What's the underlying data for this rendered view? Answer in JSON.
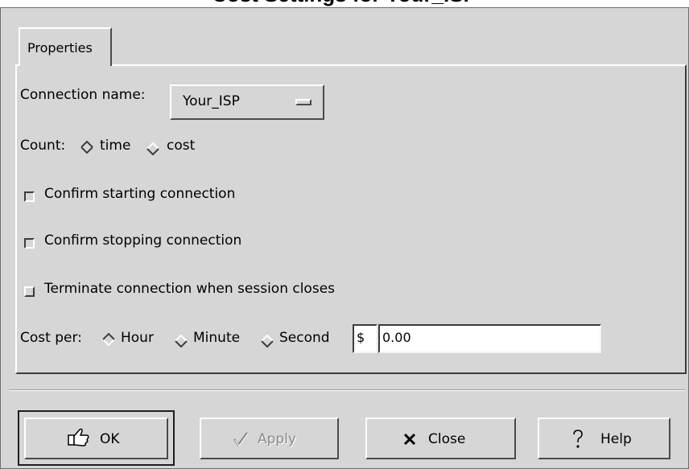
{
  "window": {
    "title": "Cost Settings for Your_ISP"
  },
  "tabs": [
    {
      "label": "Properties"
    }
  ],
  "form": {
    "connection_name_label": "Connection name:",
    "connection_name_value": "Your_ISP",
    "count_label": "Count:",
    "count_options": [
      {
        "label": "time",
        "selected": true
      },
      {
        "label": "cost",
        "selected": false
      }
    ],
    "confirm_start_label": "Confirm starting connection",
    "confirm_start_checked": false,
    "confirm_stop_label": "Confirm stopping connection",
    "confirm_stop_checked": false,
    "terminate_label": "Terminate connection when session closes",
    "terminate_checked": false,
    "cost_per_label": "Cost per:",
    "cost_per_options": [
      {
        "label": "Hour",
        "selected": true
      },
      {
        "label": "Minute",
        "selected": false
      },
      {
        "label": "Second",
        "selected": false
      }
    ],
    "currency_value": "$",
    "cost_value": "0.00"
  },
  "buttons": {
    "ok": {
      "label": "OK",
      "icon": "ok-hand-icon"
    },
    "apply": {
      "label": "Apply",
      "icon": "checkmark-icon",
      "disabled": true
    },
    "close": {
      "label": "Close",
      "icon": "x-close-icon"
    },
    "help": {
      "label": "Help",
      "icon": "question-icon"
    }
  }
}
